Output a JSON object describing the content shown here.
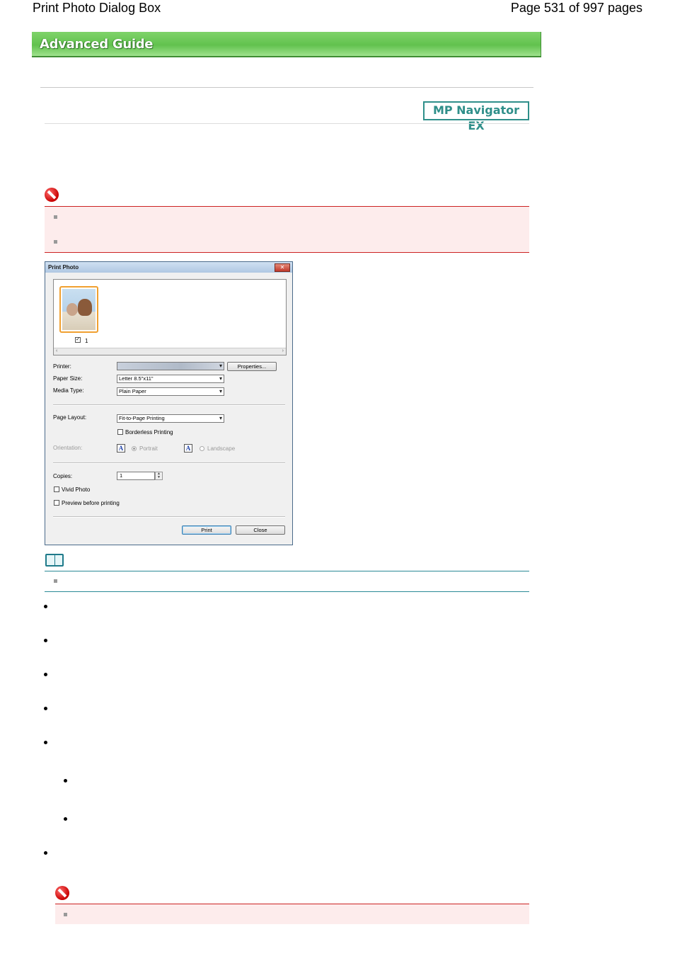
{
  "header": {
    "left_title": "Print Photo Dialog Box",
    "page_info": "Page 531 of 997 pages"
  },
  "banner": {
    "label": "Advanced Guide"
  },
  "product_tag": "MP Navigator EX",
  "dialog": {
    "title": "Print Photo",
    "close_glyph": "✕",
    "thumbnail_number": "1",
    "scroll_left": "‹",
    "scroll_right": "›",
    "printer_label": "Printer:",
    "printer_value": "",
    "properties_button": "Properties...",
    "paper_size_label": "Paper Size:",
    "paper_size_value": "Letter 8.5\"x11\"",
    "media_type_label": "Media Type:",
    "media_type_value": "Plain Paper",
    "page_layout_label": "Page Layout:",
    "page_layout_value": "Fit-to-Page Printing",
    "borderless_label": "Borderless Printing",
    "orientation_label": "Orientation:",
    "orientation_glyph": "A",
    "portrait_label": "Portrait",
    "landscape_label": "Landscape",
    "copies_label": "Copies:",
    "copies_value": "1",
    "vivid_label": "Vivid Photo",
    "preview_label": "Preview before printing",
    "print_button": "Print",
    "close_button": "Close"
  },
  "colors": {
    "banner_green": "#62c24e",
    "important_red": "#cc2222",
    "important_bg": "#fdecec",
    "note_teal": "#2a8a96",
    "product_tag_teal": "#2f8f8a"
  },
  "icons": [
    "important-icon",
    "note-icon",
    "bullet-square",
    "bullet-dot"
  ]
}
